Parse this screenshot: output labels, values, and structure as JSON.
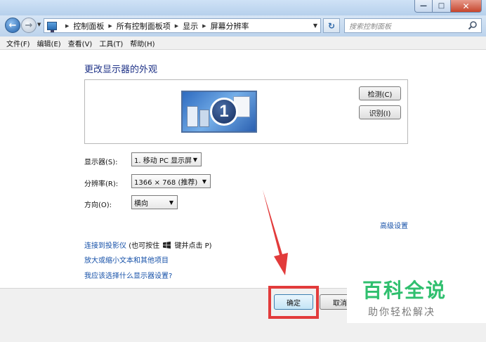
{
  "nav": {
    "breadcrumbs": [
      "控制面板",
      "所有控制面板项",
      "显示",
      "屏幕分辨率"
    ],
    "search_placeholder": "搜索控制面板"
  },
  "menu": [
    "文件(F)",
    "编辑(E)",
    "查看(V)",
    "工具(T)",
    "帮助(H)"
  ],
  "main": {
    "title": "更改显示器的外观",
    "monitor_number": "1",
    "detect_label": "检测(C)",
    "identify_label": "识别(I)",
    "display_label": "显示器(S):",
    "display_value": "1. 移动 PC 显示屏",
    "resolution_label": "分辨率(R):",
    "resolution_value": "1366 × 768 (推荐)",
    "orientation_label": "方向(O):",
    "orientation_value": "横向",
    "advanced_link": "高级设置",
    "projector_link": "连接到投影仪",
    "projector_hint_pre": "(也可按住",
    "projector_hint_post": "键并点击 P)",
    "text_size_link": "放大或缩小文本和其他项目",
    "help_link": "我应该选择什么显示器设置?"
  },
  "footer": {
    "ok_label": "确定",
    "cancel_label": "取消"
  },
  "watermark": {
    "title": "百科全说",
    "subtitle": "助你轻松解决"
  },
  "colors": {
    "highlight": "#e23b3b",
    "link": "#1550a8",
    "watermark_green": "#2fbf6e"
  }
}
